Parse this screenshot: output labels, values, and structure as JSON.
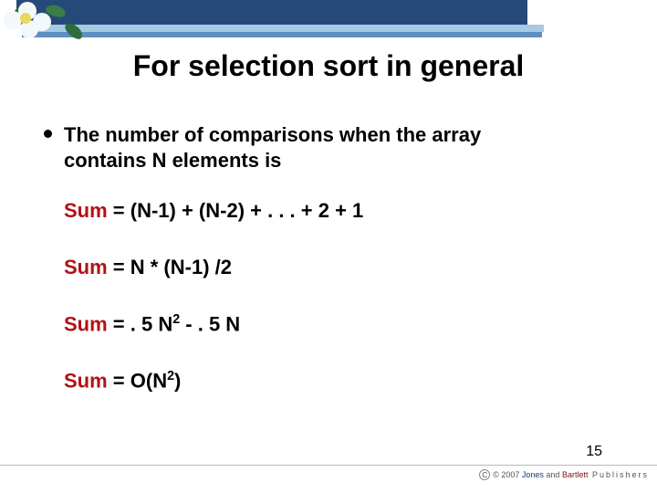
{
  "title": "For selection sort in general",
  "bullet": "The number of comparisons when the array contains N elements is",
  "equations": {
    "sum_label": "Sum",
    "eq1_rhs": " = (N-1)  +   (N-2)  + .   .   .   +  2  +  1",
    "eq2_rhs": "  = N * (N-1) /2",
    "eq3_pre": " = . 5 N",
    "eq3_exp": "2",
    "eq3_post": " - . 5 N",
    "eq4_pre": " = O(N",
    "eq4_exp": "2",
    "eq4_post": ")"
  },
  "page_number": "15",
  "copyright": {
    "year": "© 2007",
    "jones": "Jones",
    "and": " and ",
    "bartlett": "Bartlett",
    "publishers": " Publishers"
  }
}
